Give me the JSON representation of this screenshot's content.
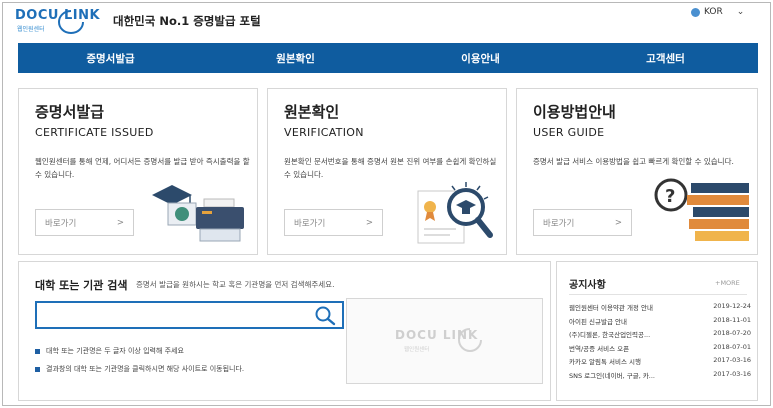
{
  "header": {
    "logo_text": "DOCU LINK",
    "logo_sub": "웹인원센터",
    "site_title": "대한민국 No.1 증명발급 포털",
    "language": "KOR"
  },
  "nav": [
    "증명서발급",
    "원본확인",
    "이용안내",
    "고객센터"
  ],
  "cards": [
    {
      "title_ko": "증명서발급",
      "title_en": "CERTIFICATE ISSUED",
      "desc": "웹인원센터를 통해 언제, 어디서든 증명서를 발급 받아 즉시출력을 할 수 있습니다.",
      "button": "바로가기"
    },
    {
      "title_ko": "원본확인",
      "title_en": "VERIFICATION",
      "desc": "원본확인 문서번호을 통해 증명서 원본 진위 여부를 손쉽게 확인하실 수 있습니다.",
      "button": "바로가기"
    },
    {
      "title_ko": "이용방법안내",
      "title_en": "USER GUIDE",
      "desc": "증명서 발급 서비스 이용방법을 쉽고 빠르게 확인할 수 있습니다.",
      "button": "바로가기"
    }
  ],
  "search": {
    "title": "대학 또는 기관 검색",
    "subtitle": "증명서 발급을 원하시는 학교 혹은 기관명을 먼저 검색해주세요.",
    "placeholder": "",
    "notes": [
      "대학 또는 기관명은 두 글자 이상 입력해 주세요",
      "결과창의 대학 또는 기관명을 클릭하시면 해당 사이트로 이동됩니다."
    ],
    "watermark": "DOCU LINK",
    "watermark_sub": "웹인원센터"
  },
  "notice": {
    "title": "공지사항",
    "more": "+MORE",
    "items": [
      {
        "title": "웹인원센터 이용약관 개정 안내",
        "date": "2019-12-24"
      },
      {
        "title": "아이핀 신규발급 안내",
        "date": "2018-11-01"
      },
      {
        "title": "(주)디젤론, 한국산업인력공...",
        "date": "2018-07-20"
      },
      {
        "title": "번역/공증 서비스 오픈",
        "date": "2018-07-01"
      },
      {
        "title": "카카오 알림톡 서비스 시행",
        "date": "2017-03-16"
      },
      {
        "title": "SNS 로그인(네이버, 구글, 카...",
        "date": "2017-03-16"
      }
    ]
  },
  "colors": {
    "nav": "#0f5c9f",
    "accent": "#1e6fb8"
  }
}
